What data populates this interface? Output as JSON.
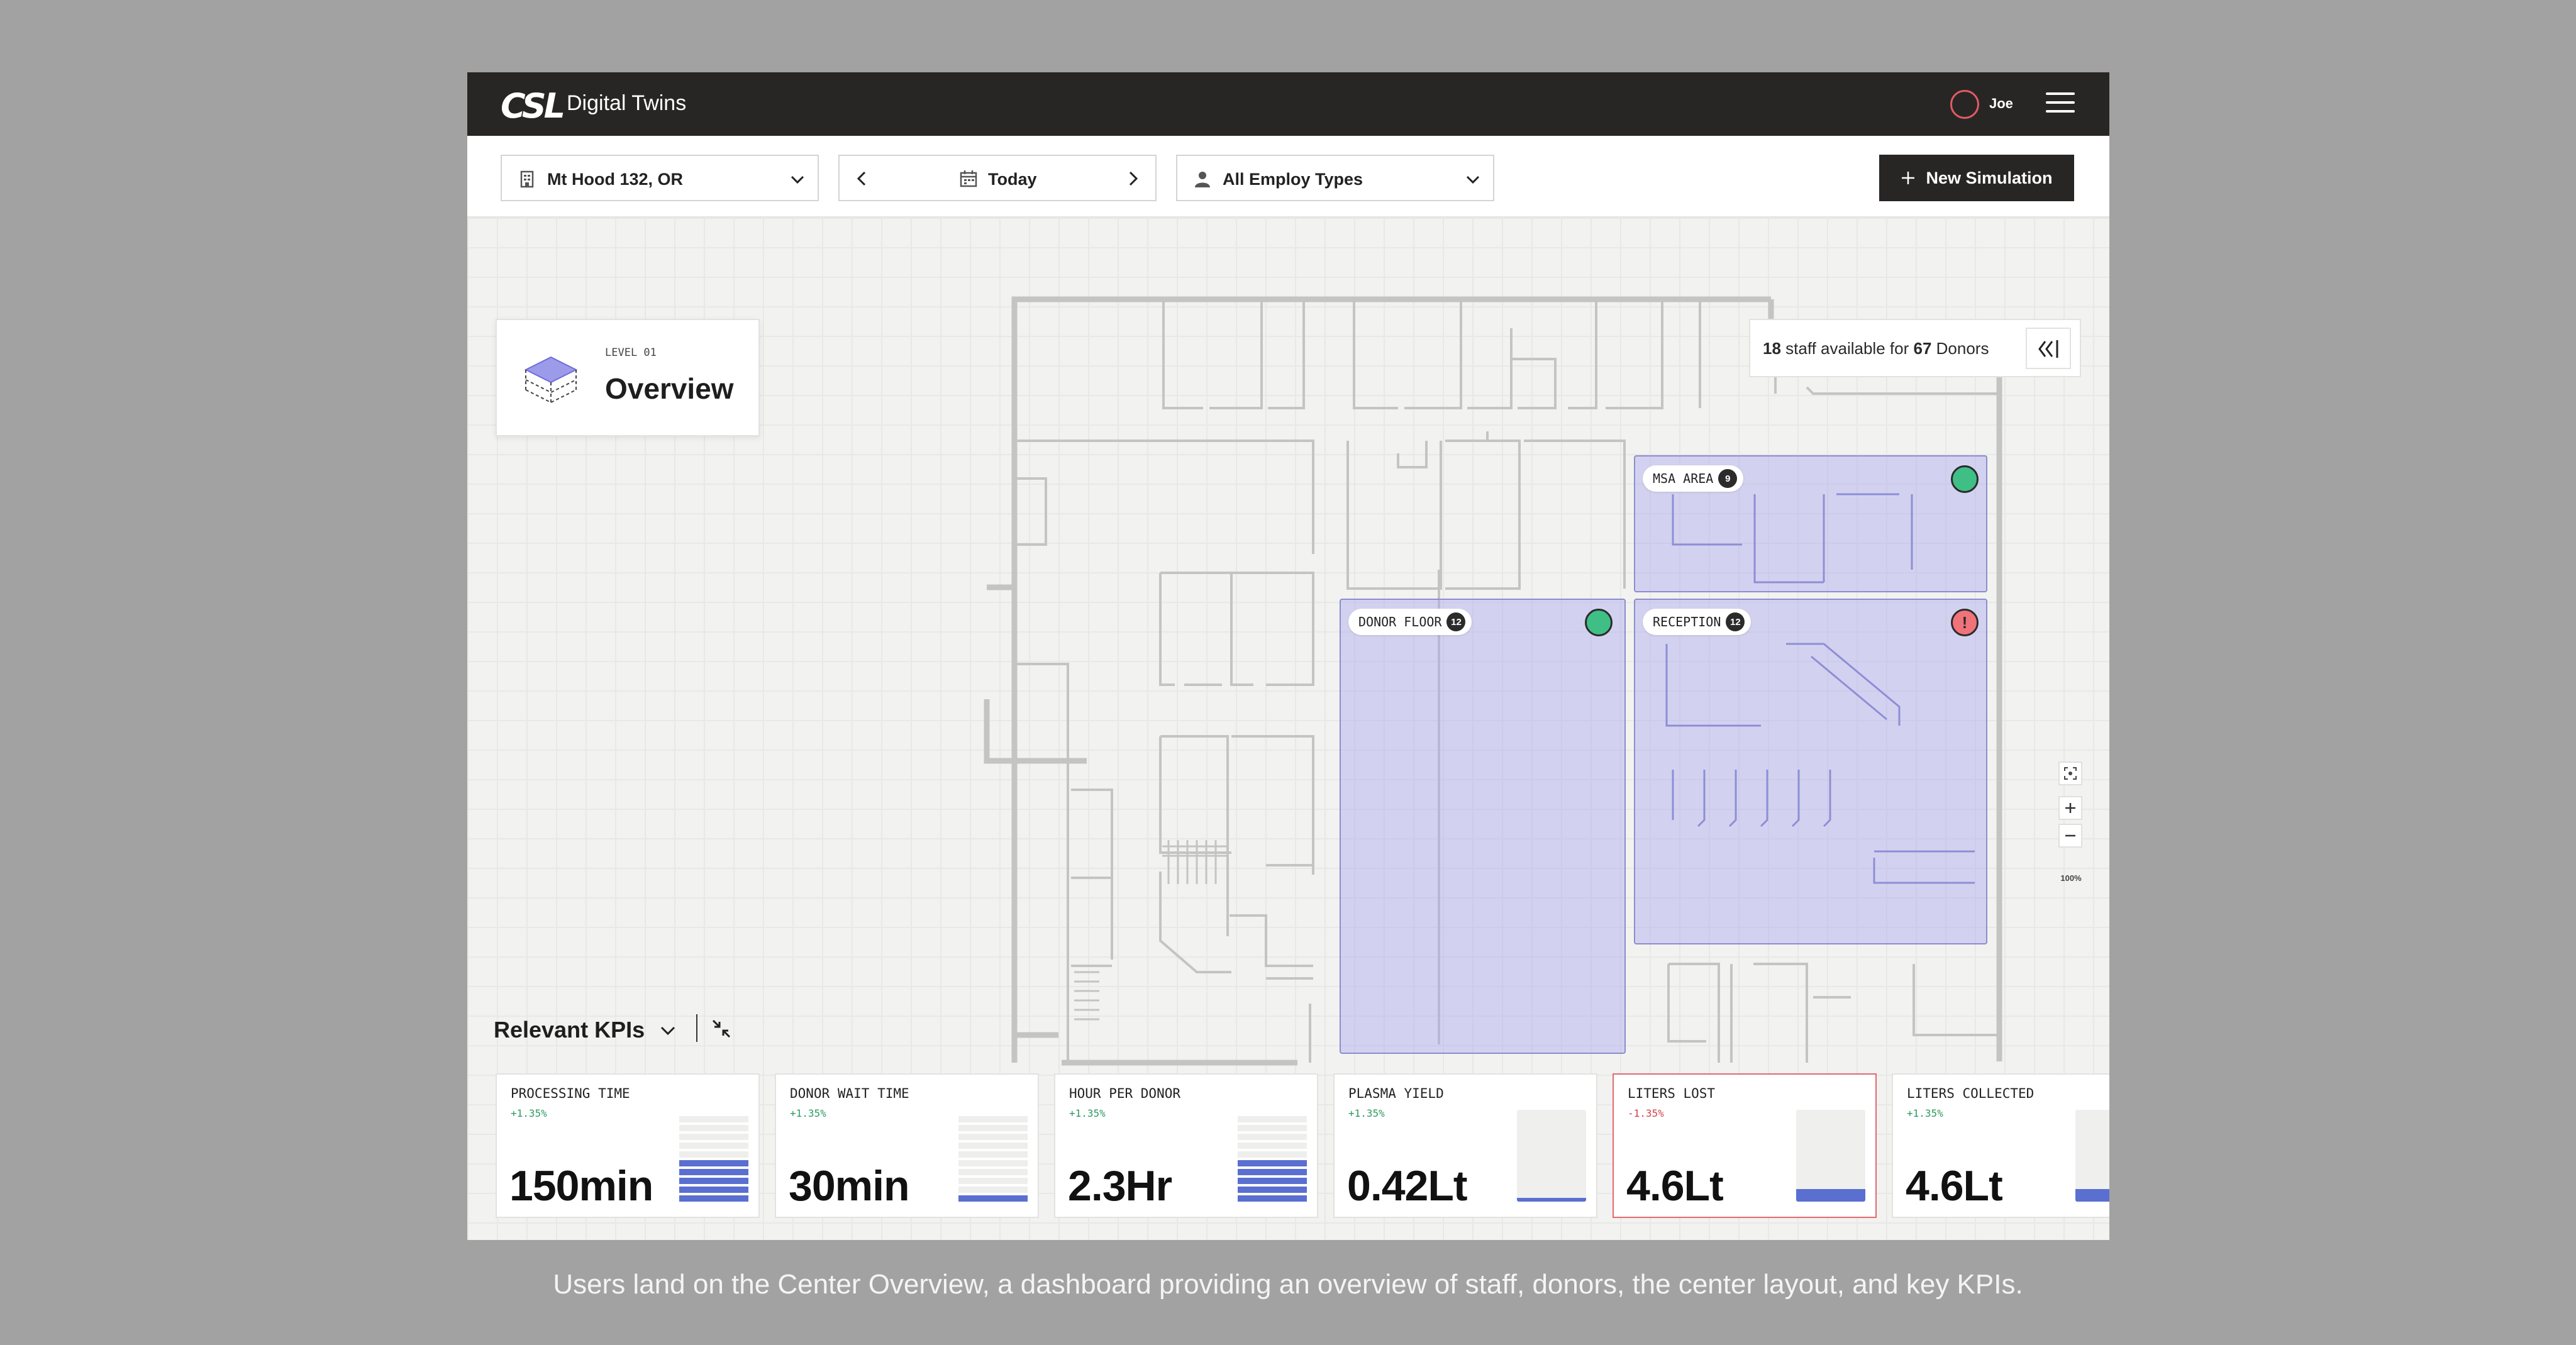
{
  "app": {
    "logo": "CSL",
    "title": "Digital Twins"
  },
  "user": {
    "name": "Joe"
  },
  "filters": {
    "location": "Mt Hood 132, OR",
    "date": "Today",
    "employ_types": "All Employ Types",
    "new_simulation": "New Simulation"
  },
  "level": {
    "label": "LEVEL 01",
    "title": "Overview"
  },
  "staff": {
    "count": "18",
    "mid": "staff available for",
    "donors": "67",
    "suffix": "Donors"
  },
  "zoom": {
    "level": "100%"
  },
  "zones": {
    "msa": {
      "name": "MSA AREA",
      "count": "9",
      "status": "ok"
    },
    "donor_floor": {
      "name": "DONOR FLOOR",
      "count": "12",
      "status": "ok"
    },
    "reception": {
      "name": "RECEPTION",
      "count": "12",
      "status": "alert",
      "alert_glyph": "!"
    }
  },
  "kpis": {
    "heading": "Relevant KPIs",
    "cards": [
      {
        "label": "PROCESSING TIME",
        "delta": "+1.35%",
        "value": "150min",
        "level": 0.45,
        "kind": "bars"
      },
      {
        "label": "DONOR WAIT TIME",
        "delta": "+1.35%",
        "value": "30min",
        "level": 0.1,
        "kind": "bars"
      },
      {
        "label": "HOUR PER DONOR",
        "delta": "+1.35%",
        "value": "2.3Hr",
        "level": 0.45,
        "kind": "bars"
      },
      {
        "label": "PLASMA YIELD",
        "delta": "+1.35%",
        "value": "0.42Lt",
        "level": 0.04,
        "kind": "fill"
      },
      {
        "label": "LITERS LOST",
        "delta": "-1.35%",
        "value": "4.6Lt",
        "level": 0.14,
        "kind": "fill",
        "alert": true
      },
      {
        "label": "LITERS COLLECTED",
        "delta": "+1.35%",
        "value": "4.6Lt",
        "level": 0.14,
        "kind": "fill"
      }
    ]
  },
  "caption": "Users land on the Center Overview, a dashboard providing an  overview of staff, donors, the center layout, and key KPIs.",
  "colors": {
    "accent": "#5a6fd0",
    "zone": "#aaaaf0",
    "ok": "#3fbf86",
    "alert": "#f0737a",
    "topbar": "#272624"
  }
}
